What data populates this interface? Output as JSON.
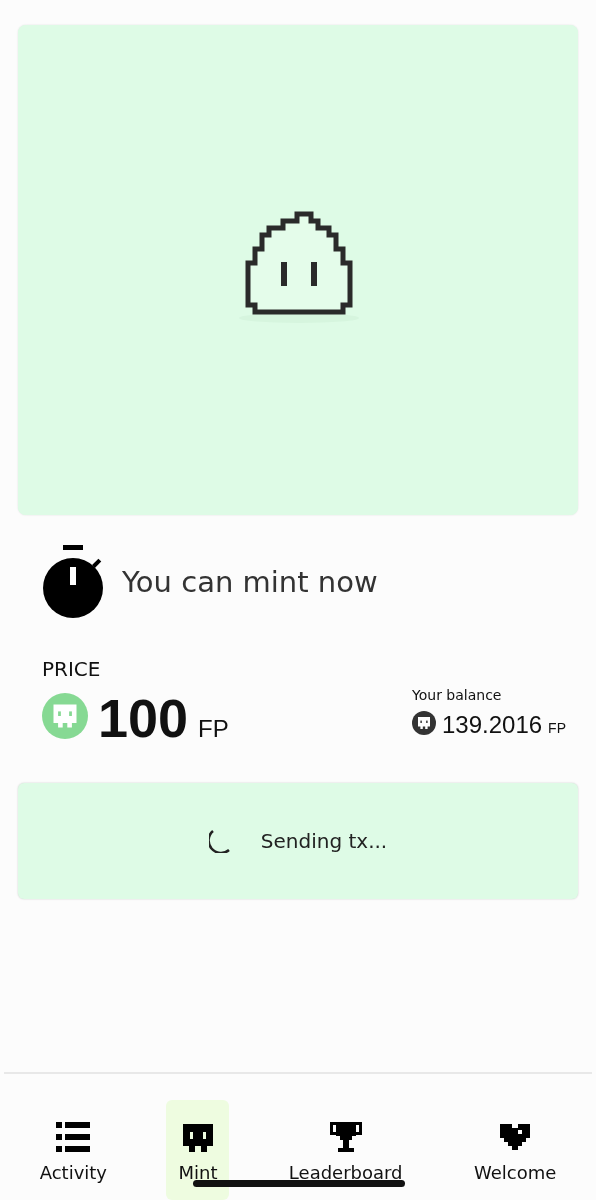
{
  "status": {
    "text": "You can mint now"
  },
  "price": {
    "label": "PRICE",
    "amount": "100",
    "unit": "FP"
  },
  "balance": {
    "label": "Your balance",
    "amount": "139.2016",
    "unit": "FP"
  },
  "mint_button": {
    "label": "Sending tx...",
    "loading": true
  },
  "nav": [
    {
      "label": "Activity",
      "selected": false
    },
    {
      "label": "Mint",
      "selected": true
    },
    {
      "label": "Leaderboard",
      "selected": false
    },
    {
      "label": "Welcome",
      "selected": false
    }
  ]
}
